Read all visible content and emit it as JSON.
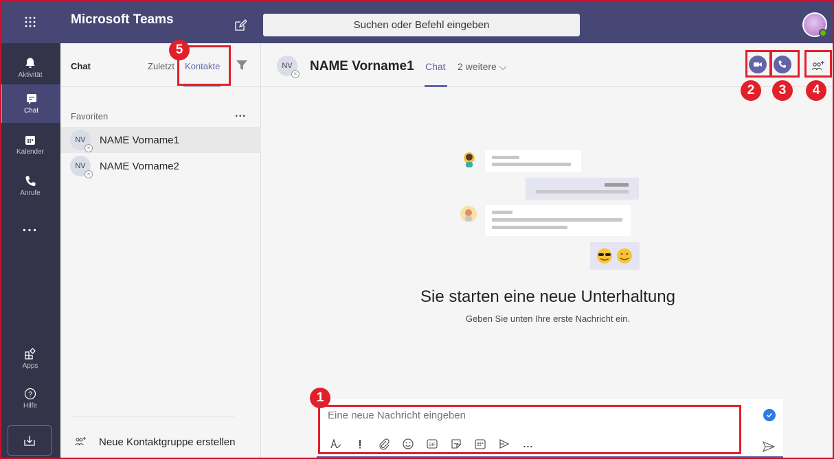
{
  "topbar": {
    "waffle_icon": "waffle-grid-icon",
    "app_title": "Microsoft Teams",
    "compose_icon": "new-chat-icon",
    "search_placeholder": "Suchen oder Befehl eingeben",
    "accent": "#464775"
  },
  "rail": {
    "items": [
      {
        "label": "Aktivität",
        "icon": "bell-icon"
      },
      {
        "label": "Chat",
        "icon": "chat-icon"
      },
      {
        "label": "Kalender",
        "icon": "calendar-icon"
      },
      {
        "label": "Anrufe",
        "icon": "phone-icon"
      },
      {
        "label": "...",
        "icon": "more-icon"
      },
      {
        "label": "Apps",
        "icon": "apps-icon"
      },
      {
        "label": "Hilfe",
        "icon": "help-icon"
      }
    ],
    "active_item": "Chat",
    "download_icon": "download-icon"
  },
  "list": {
    "title": "Chat",
    "tab_recent": "Zuletzt",
    "tab_contacts": "Kontakte",
    "filter_icon": "filter-icon",
    "favorites_label": "Favoriten",
    "favorites_more": "...",
    "contacts": [
      {
        "initials": "NV",
        "name": "NAME Vorname1"
      },
      {
        "initials": "NV",
        "name": "NAME Vorname2"
      }
    ],
    "new_group_label": "Neue Kontaktgruppe erstellen"
  },
  "main": {
    "header": {
      "initials": "NV",
      "name": "NAME Vorname1",
      "tab_chat": "Chat",
      "tab_more": "2 weitere ⌵"
    },
    "empty_title": "Sie starten eine neue Unterhaltung",
    "empty_subtitle": "Geben Sie unten Ihre erste Nachricht ein.",
    "compose_placeholder": "Eine neue Nachricht eingeben",
    "toolbar_more": "..."
  },
  "annotations": {
    "badges": [
      "1",
      "2",
      "3",
      "4",
      "5"
    ],
    "color": "#e0202a"
  }
}
